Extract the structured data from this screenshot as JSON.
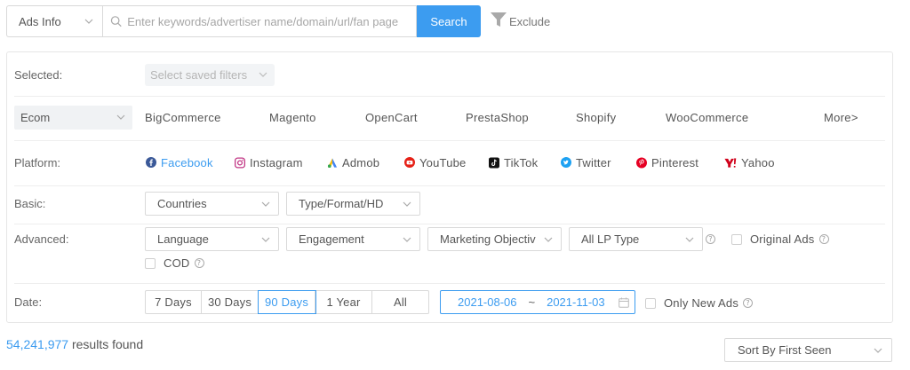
{
  "search": {
    "type_select": "Ads Info",
    "placeholder": "Enter keywords/advertiser name/domain/url/fan page",
    "value": "",
    "button": "Search",
    "exclude": "Exclude"
  },
  "selected": {
    "label": "Selected:",
    "saved_filters_placeholder": "Select saved filters"
  },
  "ecom": {
    "select_value": "Ecom",
    "items": [
      "BigCommerce",
      "Magento",
      "OpenCart",
      "PrestaShop",
      "Shopify",
      "WooCommerce"
    ],
    "more": "More>"
  },
  "platform": {
    "label": "Platform:",
    "items": [
      {
        "name": "Facebook",
        "icon": "facebook-icon",
        "active": true
      },
      {
        "name": "Instagram",
        "icon": "instagram-icon",
        "active": false
      },
      {
        "name": "Admob",
        "icon": "admob-icon",
        "active": false
      },
      {
        "name": "YouTube",
        "icon": "youtube-icon",
        "active": false
      },
      {
        "name": "TikTok",
        "icon": "tiktok-icon",
        "active": false
      },
      {
        "name": "Twitter",
        "icon": "twitter-icon",
        "active": false
      },
      {
        "name": "Pinterest",
        "icon": "pinterest-icon",
        "active": false
      },
      {
        "name": "Yahoo",
        "icon": "yahoo-icon",
        "active": false
      }
    ]
  },
  "basic": {
    "label": "Basic:",
    "countries": "Countries",
    "type_format": "Type/Format/HD"
  },
  "advanced": {
    "label": "Advanced:",
    "language": "Language",
    "engagement": "Engagement",
    "marketing_objective": "Marketing Objectiv",
    "lp_type": "All LP Type",
    "original_ads": "Original Ads",
    "cod": "COD"
  },
  "date": {
    "label": "Date:",
    "ranges": [
      "7 Days",
      "30 Days",
      "90 Days",
      "1 Year",
      "All"
    ],
    "active_range": "90 Days",
    "start": "2021-08-06",
    "separator": "~",
    "end": "2021-11-03",
    "only_new_ads": "Only New Ads"
  },
  "results": {
    "count": "54,241,977",
    "suffix": " results found"
  },
  "sort": {
    "value": "Sort By First Seen"
  },
  "colors": {
    "accent": "#3c9cf0",
    "facebook": "#3b5998",
    "instagram": "#c13584",
    "youtube": "#e62117",
    "tiktok": "#111111",
    "twitter": "#1da1f2",
    "pinterest": "#e60023",
    "yahoo": "#d0021b"
  }
}
